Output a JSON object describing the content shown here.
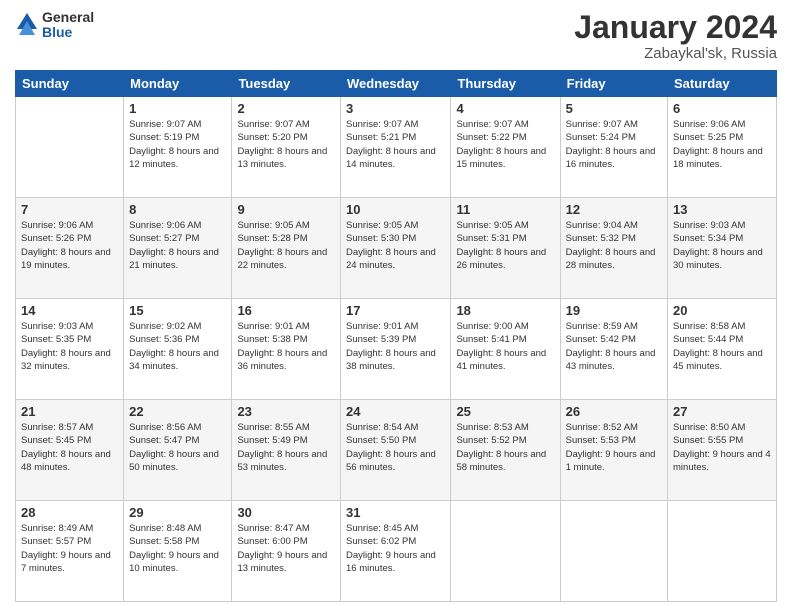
{
  "logo": {
    "general": "General",
    "blue": "Blue"
  },
  "header": {
    "month": "January 2024",
    "location": "Zabaykal'sk, Russia"
  },
  "weekdays": [
    "Sunday",
    "Monday",
    "Tuesday",
    "Wednesday",
    "Thursday",
    "Friday",
    "Saturday"
  ],
  "weeks": [
    [
      {
        "day": "",
        "sunrise": "",
        "sunset": "",
        "daylight": ""
      },
      {
        "day": "1",
        "sunrise": "9:07 AM",
        "sunset": "5:19 PM",
        "daylight": "8 hours and 12 minutes."
      },
      {
        "day": "2",
        "sunrise": "9:07 AM",
        "sunset": "5:20 PM",
        "daylight": "8 hours and 13 minutes."
      },
      {
        "day": "3",
        "sunrise": "9:07 AM",
        "sunset": "5:21 PM",
        "daylight": "8 hours and 14 minutes."
      },
      {
        "day": "4",
        "sunrise": "9:07 AM",
        "sunset": "5:22 PM",
        "daylight": "8 hours and 15 minutes."
      },
      {
        "day": "5",
        "sunrise": "9:07 AM",
        "sunset": "5:24 PM",
        "daylight": "8 hours and 16 minutes."
      },
      {
        "day": "6",
        "sunrise": "9:06 AM",
        "sunset": "5:25 PM",
        "daylight": "8 hours and 18 minutes."
      }
    ],
    [
      {
        "day": "7",
        "sunrise": "9:06 AM",
        "sunset": "5:26 PM",
        "daylight": "8 hours and 19 minutes."
      },
      {
        "day": "8",
        "sunrise": "9:06 AM",
        "sunset": "5:27 PM",
        "daylight": "8 hours and 21 minutes."
      },
      {
        "day": "9",
        "sunrise": "9:05 AM",
        "sunset": "5:28 PM",
        "daylight": "8 hours and 22 minutes."
      },
      {
        "day": "10",
        "sunrise": "9:05 AM",
        "sunset": "5:30 PM",
        "daylight": "8 hours and 24 minutes."
      },
      {
        "day": "11",
        "sunrise": "9:05 AM",
        "sunset": "5:31 PM",
        "daylight": "8 hours and 26 minutes."
      },
      {
        "day": "12",
        "sunrise": "9:04 AM",
        "sunset": "5:32 PM",
        "daylight": "8 hours and 28 minutes."
      },
      {
        "day": "13",
        "sunrise": "9:03 AM",
        "sunset": "5:34 PM",
        "daylight": "8 hours and 30 minutes."
      }
    ],
    [
      {
        "day": "14",
        "sunrise": "9:03 AM",
        "sunset": "5:35 PM",
        "daylight": "8 hours and 32 minutes."
      },
      {
        "day": "15",
        "sunrise": "9:02 AM",
        "sunset": "5:36 PM",
        "daylight": "8 hours and 34 minutes."
      },
      {
        "day": "16",
        "sunrise": "9:01 AM",
        "sunset": "5:38 PM",
        "daylight": "8 hours and 36 minutes."
      },
      {
        "day": "17",
        "sunrise": "9:01 AM",
        "sunset": "5:39 PM",
        "daylight": "8 hours and 38 minutes."
      },
      {
        "day": "18",
        "sunrise": "9:00 AM",
        "sunset": "5:41 PM",
        "daylight": "8 hours and 41 minutes."
      },
      {
        "day": "19",
        "sunrise": "8:59 AM",
        "sunset": "5:42 PM",
        "daylight": "8 hours and 43 minutes."
      },
      {
        "day": "20",
        "sunrise": "8:58 AM",
        "sunset": "5:44 PM",
        "daylight": "8 hours and 45 minutes."
      }
    ],
    [
      {
        "day": "21",
        "sunrise": "8:57 AM",
        "sunset": "5:45 PM",
        "daylight": "8 hours and 48 minutes."
      },
      {
        "day": "22",
        "sunrise": "8:56 AM",
        "sunset": "5:47 PM",
        "daylight": "8 hours and 50 minutes."
      },
      {
        "day": "23",
        "sunrise": "8:55 AM",
        "sunset": "5:49 PM",
        "daylight": "8 hours and 53 minutes."
      },
      {
        "day": "24",
        "sunrise": "8:54 AM",
        "sunset": "5:50 PM",
        "daylight": "8 hours and 56 minutes."
      },
      {
        "day": "25",
        "sunrise": "8:53 AM",
        "sunset": "5:52 PM",
        "daylight": "8 hours and 58 minutes."
      },
      {
        "day": "26",
        "sunrise": "8:52 AM",
        "sunset": "5:53 PM",
        "daylight": "9 hours and 1 minute."
      },
      {
        "day": "27",
        "sunrise": "8:50 AM",
        "sunset": "5:55 PM",
        "daylight": "9 hours and 4 minutes."
      }
    ],
    [
      {
        "day": "28",
        "sunrise": "8:49 AM",
        "sunset": "5:57 PM",
        "daylight": "9 hours and 7 minutes."
      },
      {
        "day": "29",
        "sunrise": "8:48 AM",
        "sunset": "5:58 PM",
        "daylight": "9 hours and 10 minutes."
      },
      {
        "day": "30",
        "sunrise": "8:47 AM",
        "sunset": "6:00 PM",
        "daylight": "9 hours and 13 minutes."
      },
      {
        "day": "31",
        "sunrise": "8:45 AM",
        "sunset": "6:02 PM",
        "daylight": "9 hours and 16 minutes."
      },
      {
        "day": "",
        "sunrise": "",
        "sunset": "",
        "daylight": ""
      },
      {
        "day": "",
        "sunrise": "",
        "sunset": "",
        "daylight": ""
      },
      {
        "day": "",
        "sunrise": "",
        "sunset": "",
        "daylight": ""
      }
    ]
  ],
  "labels": {
    "sunrise": "Sunrise:",
    "sunset": "Sunset:",
    "daylight": "Daylight:"
  }
}
